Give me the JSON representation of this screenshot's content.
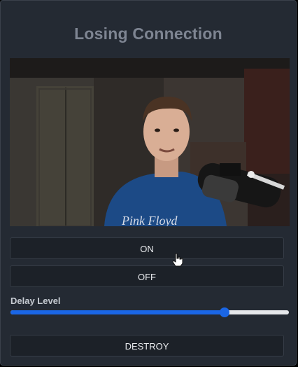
{
  "app": {
    "title": "Losing Connection"
  },
  "video": {
    "icon": "video-frame",
    "shirt_text": "Pink Floyd"
  },
  "buttons": {
    "on_label": "ON",
    "off_label": "OFF",
    "destroy_label": "DESTROY"
  },
  "delay": {
    "label": "Delay Level",
    "value_fraction": 0.77
  },
  "colors": {
    "accent": "#1a66e6",
    "background": "#242a33",
    "button_bg": "#1c2128",
    "title": "#7e8592"
  },
  "cursor": {
    "icon": "hand-pointer-icon"
  }
}
